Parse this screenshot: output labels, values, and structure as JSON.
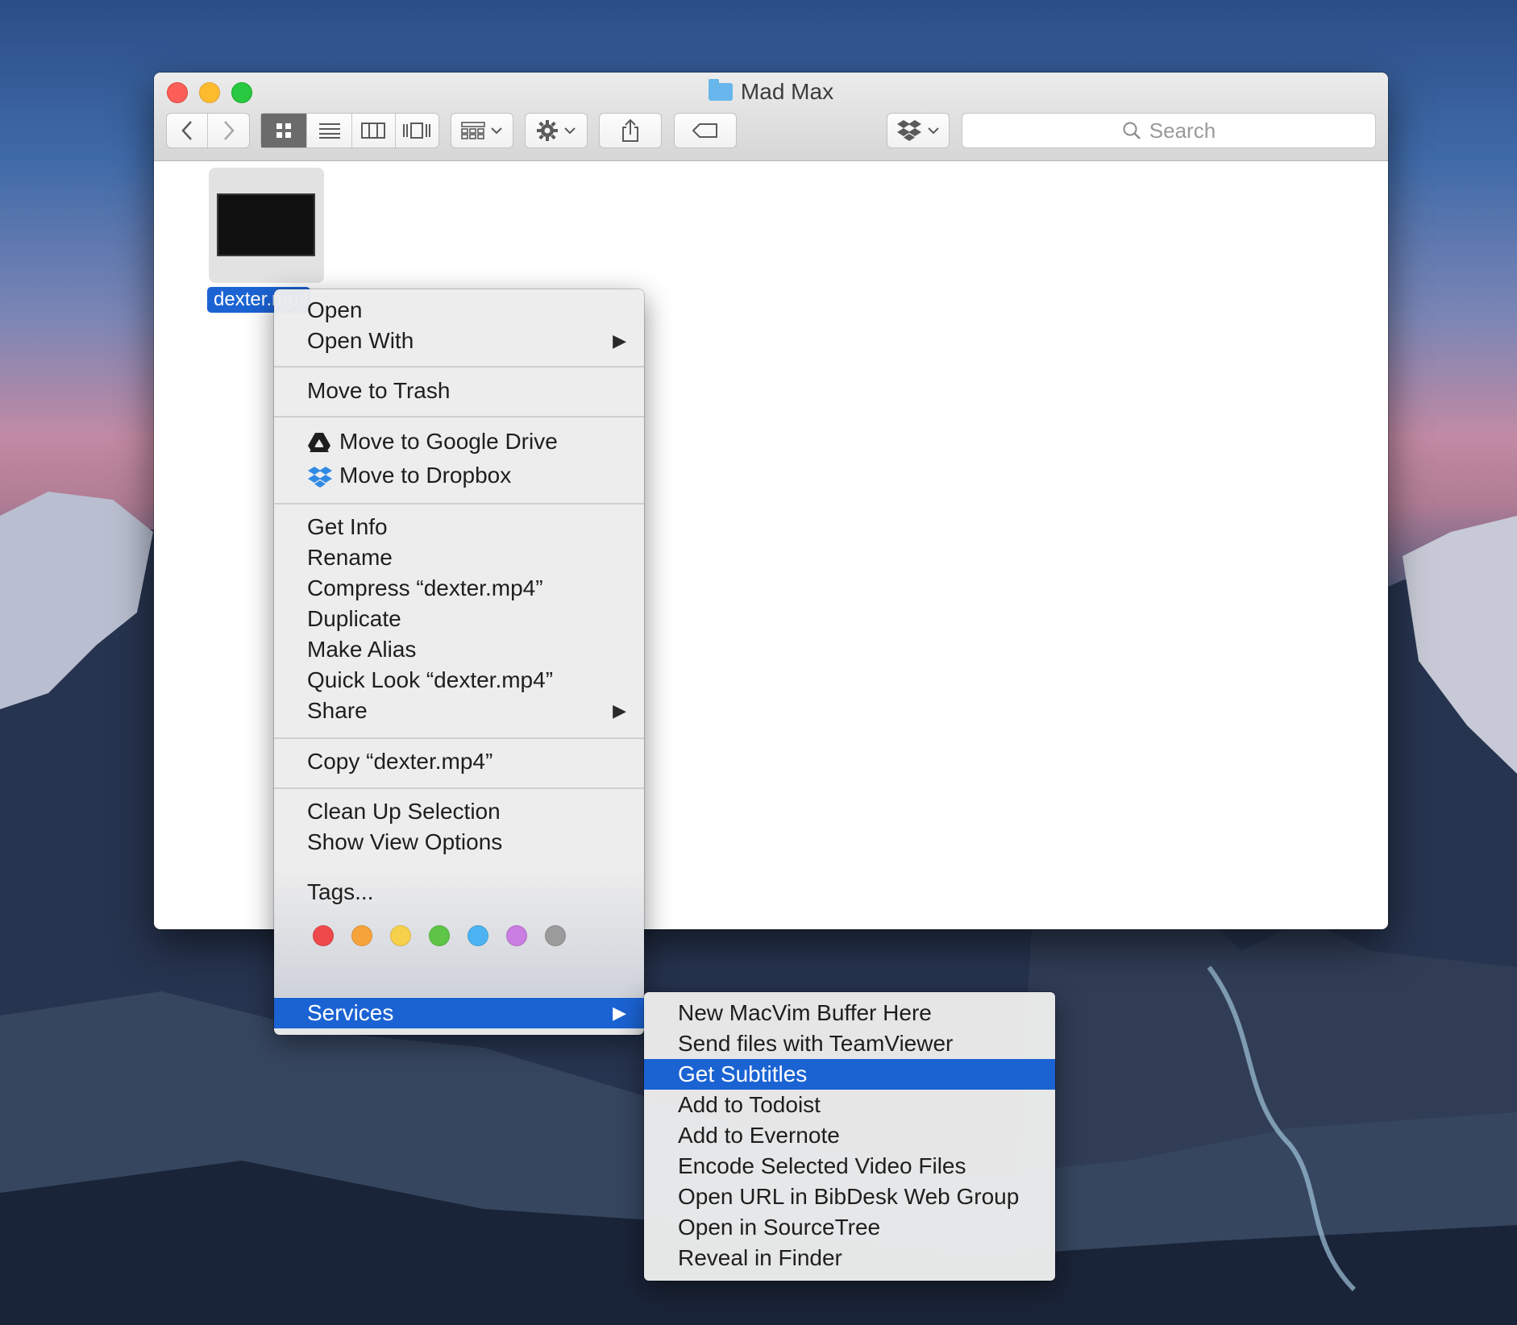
{
  "window": {
    "title": "Mad Max"
  },
  "toolbar": {
    "back_icon": "chevron-left-icon",
    "forward_icon": "chevron-right-icon",
    "view_modes": [
      "icon-view",
      "list-view",
      "column-view",
      "cover-flow-view"
    ],
    "active_view": "icon-view",
    "arrange_icon": "arrange-grid-icon",
    "action_icon": "gear-icon",
    "share_icon": "share-icon",
    "tags_icon": "tag-icon",
    "dropbox_icon": "dropbox-icon",
    "search_placeholder": "Search"
  },
  "file": {
    "label": "dexter.mp4"
  },
  "context_menu": {
    "groups": [
      {
        "items": [
          {
            "label": "Open"
          },
          {
            "label": "Open With",
            "submenu": true
          }
        ]
      },
      {
        "items": [
          {
            "label": "Move to Trash"
          }
        ]
      },
      {
        "items": [
          {
            "label": "Move to Google Drive",
            "icon": "google-drive-icon"
          },
          {
            "label": "Move to Dropbox",
            "icon": "dropbox-icon"
          }
        ]
      },
      {
        "items": [
          {
            "label": "Get Info"
          },
          {
            "label": "Rename"
          },
          {
            "label": "Compress “dexter.mp4”"
          },
          {
            "label": "Duplicate"
          },
          {
            "label": "Make Alias"
          },
          {
            "label": "Quick Look “dexter.mp4”"
          },
          {
            "label": "Share",
            "submenu": true
          }
        ]
      },
      {
        "items": [
          {
            "label": "Copy “dexter.mp4”"
          }
        ]
      },
      {
        "items": [
          {
            "label": "Clean Up Selection"
          },
          {
            "label": "Show View Options"
          }
        ]
      },
      {
        "items": [
          {
            "label": "Tags..."
          }
        ]
      },
      {
        "items": [
          {
            "label": "Services",
            "submenu": true,
            "highlighted": true
          }
        ]
      }
    ],
    "tag_colors": [
      "#f0494b",
      "#f7a33c",
      "#f6d04b",
      "#5fc548",
      "#4bb3f1",
      "#c97de0",
      "#9b9b9b"
    ]
  },
  "services_menu": {
    "items": [
      {
        "label": "New MacVim Buffer Here"
      },
      {
        "label": "Send files with TeamViewer"
      },
      {
        "label": "Get Subtitles",
        "highlighted": true
      },
      {
        "label": "Add to Todoist"
      },
      {
        "label": "Add to Evernote"
      },
      {
        "label": "Encode Selected Video Files"
      },
      {
        "label": "Open URL in BibDesk Web Group"
      },
      {
        "label": "Open in SourceTree"
      },
      {
        "label": "Reveal in Finder"
      }
    ]
  },
  "colors": {
    "selection": "#1b63d3",
    "close": "#fc5f57",
    "minimize": "#fdbc2e",
    "zoom": "#28c840"
  }
}
